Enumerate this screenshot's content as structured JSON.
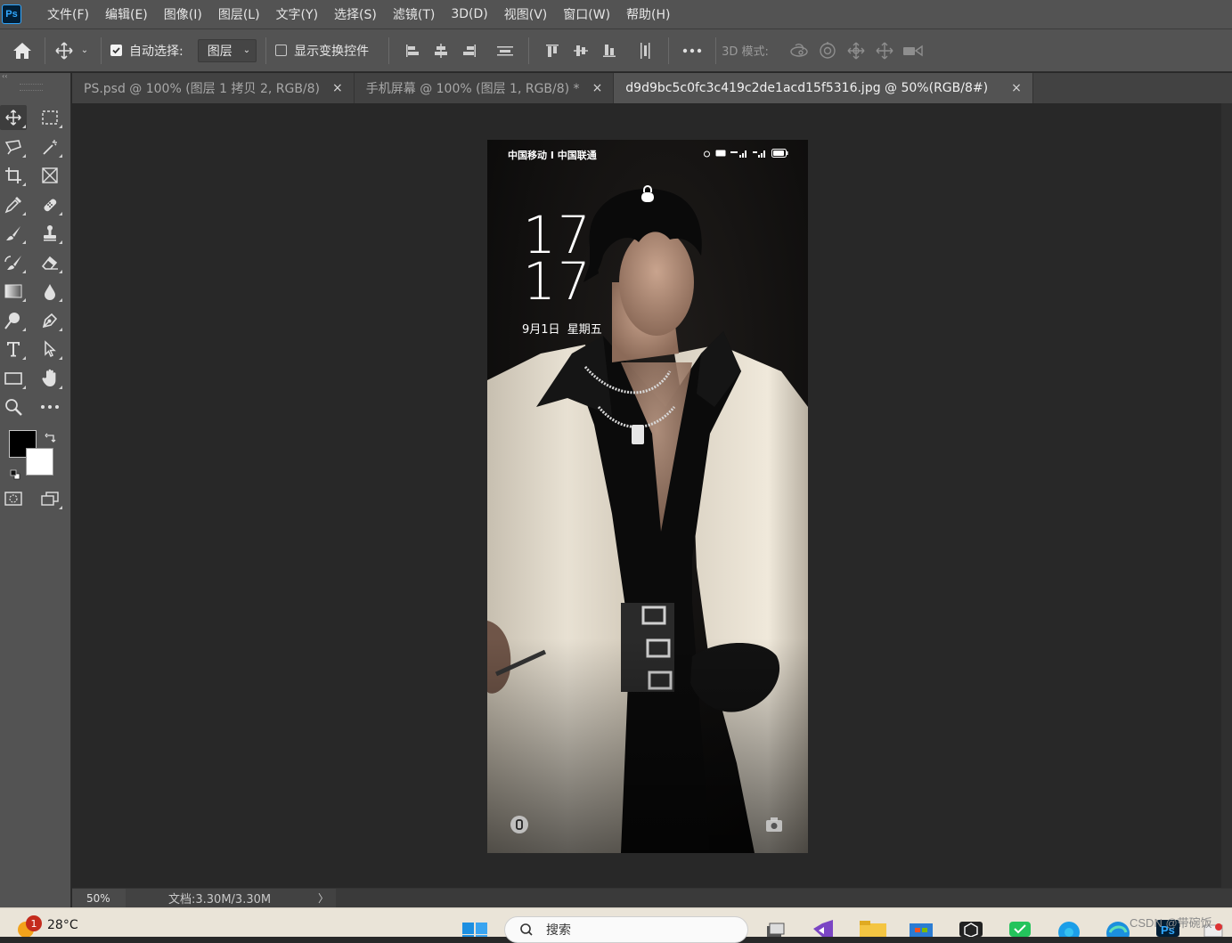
{
  "app": {
    "name": "Photoshop",
    "logo_text": "Ps"
  },
  "menu": [
    "文件(F)",
    "编辑(E)",
    "图像(I)",
    "图层(L)",
    "文字(Y)",
    "选择(S)",
    "滤镜(T)",
    "3D(D)",
    "视图(V)",
    "窗口(W)",
    "帮助(H)"
  ],
  "options": {
    "auto_select_label": "自动选择:",
    "auto_select_checked": true,
    "layer_select_value": "图层",
    "transform_controls_label": "显示变换控件",
    "transform_controls_checked": false,
    "mode_3d_label": "3D 模式:"
  },
  "tabs": [
    {
      "label": "PS.psd @ 100% (图层 1 拷贝 2, RGB/8)",
      "close": "×",
      "active": false
    },
    {
      "label": "手机屏幕 @ 100% (图层 1, RGB/8) *",
      "close": "×",
      "active": false
    },
    {
      "label": "d9d9bc5c0fc3c419c2de1acd15f5316.jpg @ 50%(RGB/8#)",
      "close": "×",
      "active": true
    }
  ],
  "document": {
    "carrier": "中国移动 I 中国联通",
    "time_hour": "17",
    "time_minute": "17",
    "date": "9月1日  星期五"
  },
  "status": {
    "zoom": "50%",
    "doc_size": "文档:3.30M/3.30M",
    "arrow": "〉"
  },
  "colors": {
    "foreground": "#000000",
    "background": "#ffffff",
    "ui_panel": "#535353",
    "canvas_bg": "#282828"
  },
  "taskbar": {
    "notification_count": "1",
    "temperature": "28°C",
    "search_placeholder": "搜索",
    "watermark": "CSDN @带碗饭"
  }
}
